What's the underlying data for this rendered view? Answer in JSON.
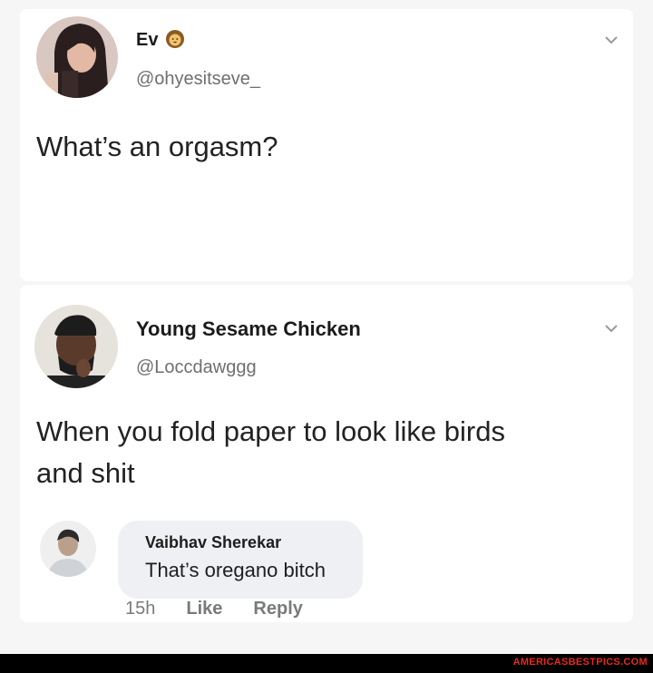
{
  "post1": {
    "name": "Ev",
    "name_icon": "lion-emoji-icon",
    "handle": "@ohyesitseve_",
    "text": "What’s an orgasm?"
  },
  "post2": {
    "name": "Young Sesame Chicken",
    "handle": "@Loccdawggg",
    "text_line1": "When you fold paper to look like birds",
    "text_line2": "and shit"
  },
  "comment": {
    "name": "Vaibhav Sherekar",
    "text": "That’s oregano bitch",
    "time": "15h",
    "like_label": "Like",
    "reply_label": "Reply"
  },
  "footer": {
    "watermark": "AMERICASBESTPICS.COM"
  },
  "colors": {
    "background": "#f6f6f6",
    "card": "#ffffff",
    "comment_bubble": "#eef0f3",
    "watermark": "#e62b1e"
  }
}
